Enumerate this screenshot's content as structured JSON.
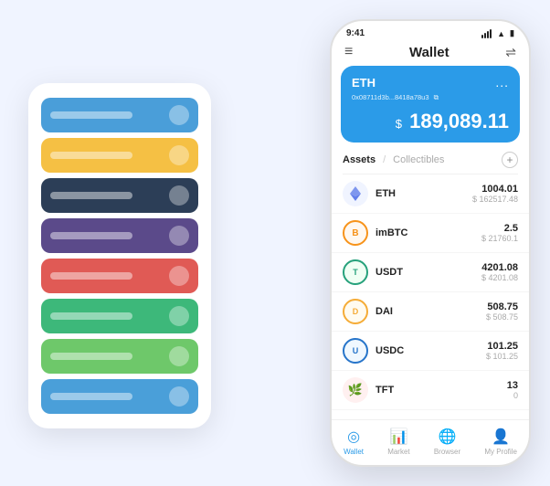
{
  "statusBar": {
    "time": "9:41",
    "icons": [
      "signal",
      "wifi",
      "battery"
    ]
  },
  "header": {
    "title": "Wallet"
  },
  "ethCard": {
    "name": "ETH",
    "address": "0x08711d3b...8418a78u3",
    "copyIcon": "⧉",
    "moreIcon": "...",
    "currencySymbol": "$",
    "amount": "189,089.11"
  },
  "assetsTabs": {
    "active": "Assets",
    "inactive": "Collectibles",
    "separator": "/"
  },
  "assets": [
    {
      "name": "ETH",
      "icon": "eth",
      "iconChar": "◆",
      "iconColor": "#627EEA",
      "amount": "1004.01",
      "usdValue": "$ 162517.48"
    },
    {
      "name": "imBTC",
      "icon": "imbtc",
      "iconChar": "⊕",
      "iconColor": "#F7931A",
      "amount": "2.5",
      "usdValue": "$ 21760.1"
    },
    {
      "name": "USDT",
      "icon": "usdt",
      "iconChar": "⬤",
      "iconColor": "#26A17B",
      "amount": "4201.08",
      "usdValue": "$ 4201.08"
    },
    {
      "name": "DAI",
      "icon": "dai",
      "iconChar": "⬤",
      "iconColor": "#F5AC37",
      "amount": "508.75",
      "usdValue": "$ 508.75"
    },
    {
      "name": "USDC",
      "icon": "usdc",
      "iconChar": "⬤",
      "iconColor": "#2775CA",
      "amount": "101.25",
      "usdValue": "$ 101.25"
    },
    {
      "name": "TFT",
      "icon": "tft",
      "iconChar": "🌿",
      "iconColor": "#E0524A",
      "amount": "13",
      "usdValue": "0"
    }
  ],
  "bottomNav": [
    {
      "label": "Wallet",
      "active": true
    },
    {
      "label": "Market",
      "active": false
    },
    {
      "label": "Browser",
      "active": false
    },
    {
      "label": "My Profile",
      "active": false
    }
  ],
  "cardStack": [
    {
      "color": "blue"
    },
    {
      "color": "yellow"
    },
    {
      "color": "dark"
    },
    {
      "color": "purple"
    },
    {
      "color": "red"
    },
    {
      "color": "green"
    },
    {
      "color": "lightgreen"
    },
    {
      "color": "lightblue"
    }
  ]
}
